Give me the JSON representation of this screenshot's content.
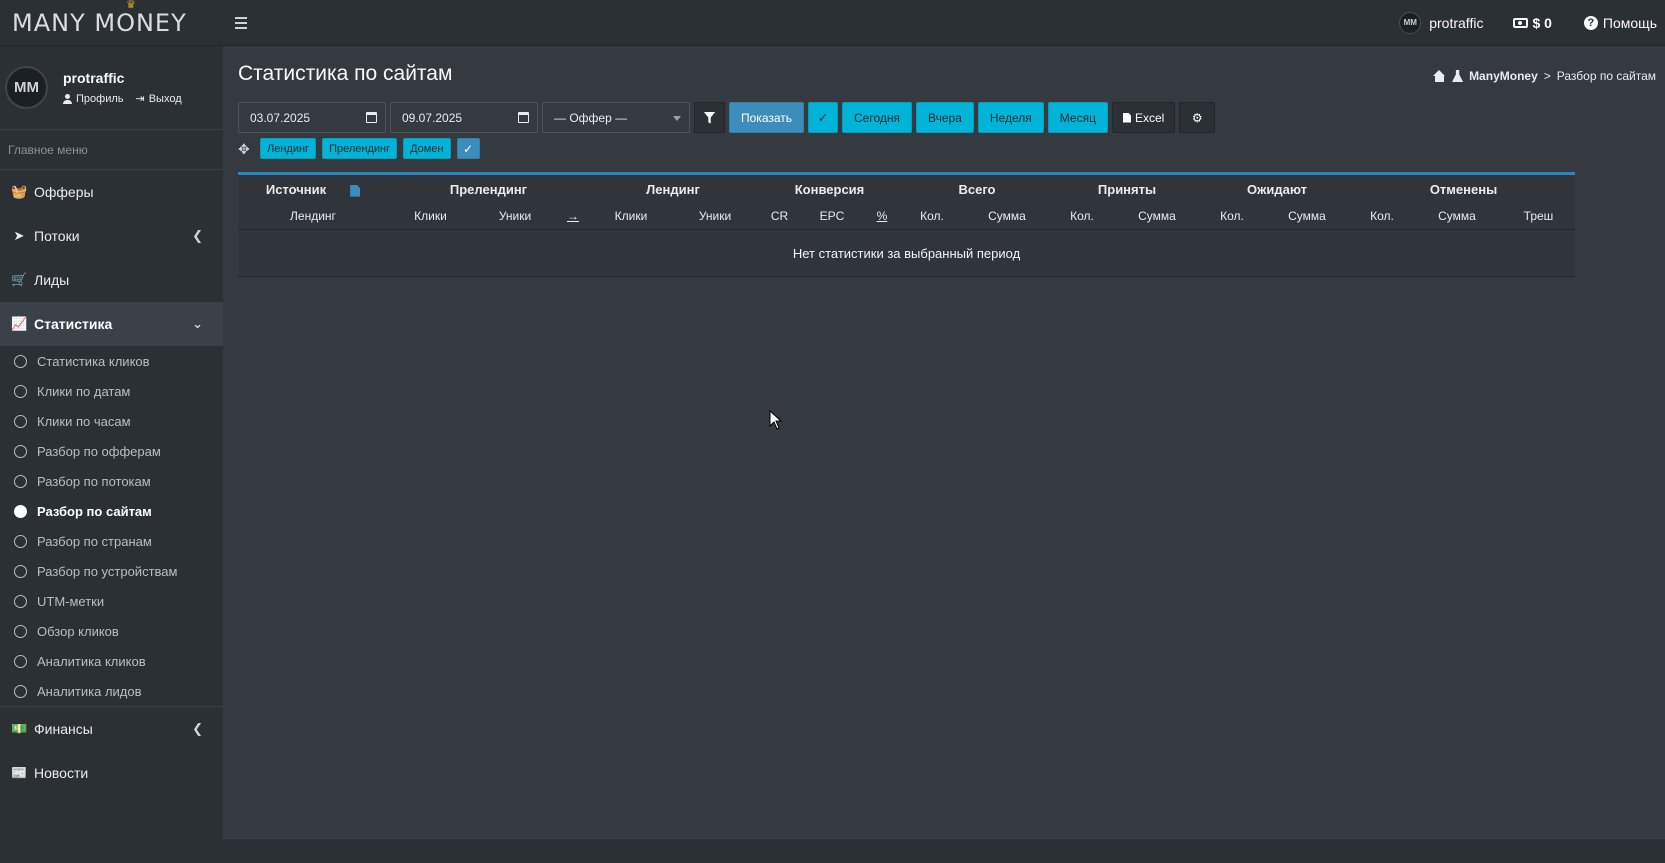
{
  "brand": {
    "logo_text": "MANY MONEY",
    "crown": "♛"
  },
  "topbar": {
    "user": "protraffic",
    "avatar_text": "MM",
    "balance": "$ 0",
    "help": "Помощь"
  },
  "sidebar": {
    "user_name": "protraffic",
    "avatar_text": "MM",
    "profile_link": "Профиль",
    "logout_link": "Выход",
    "menu_header": "Главное меню",
    "items": [
      {
        "label": "Офферы",
        "icon": "basket-icon"
      },
      {
        "label": "Потоки",
        "icon": "paper-plane-icon"
      },
      {
        "label": "Лиды",
        "icon": "cart-icon"
      },
      {
        "label": "Статистика",
        "icon": "chart-area-icon"
      },
      {
        "label": "Финансы",
        "icon": "money-icon"
      },
      {
        "label": "Новости",
        "icon": "newspaper-icon"
      }
    ],
    "stats_sub": [
      "Статистика кликов",
      "Клики по датам",
      "Клики по часам",
      "Разбор по офферам",
      "Разбор по потокам",
      "Разбор по сайтам",
      "Разбор по странам",
      "Разбор по устройствам",
      "UTM-метки",
      "Обзор кликов",
      "Аналитика кликов",
      "Аналитика лидов"
    ]
  },
  "page": {
    "title": "Статистика по сайтам",
    "breadcrumb": {
      "root": "ManyMoney",
      "sep": ">",
      "current": "Разбор по сайтам"
    }
  },
  "filters": {
    "date_from": "03.07.2025",
    "date_to": "09.07.2025",
    "offer_select": "— Оффер —",
    "show": "Показать",
    "today": "Сегодня",
    "yesterday": "Вчера",
    "week": "Неделя",
    "month": "Месяц",
    "excel": "Excel"
  },
  "group_chips": [
    "Лендинг",
    "Прелендинг",
    "Домен"
  ],
  "table": {
    "groups": [
      "Источник",
      "Прелендинг",
      "Лендинг",
      "Конверсия",
      "Всего",
      "Приняты",
      "Ожидают",
      "Отменены"
    ],
    "subheaders": [
      "Лендинг",
      "Клики",
      "Уники",
      "→",
      "Клики",
      "Уники",
      "CR",
      "EPC",
      "%",
      "Кол.",
      "Сумма",
      "Кол.",
      "Сумма",
      "Кол.",
      "Сумма",
      "Кол.",
      "Сумма",
      "Треш"
    ],
    "empty_message": "Нет статистики за выбранный период"
  },
  "colors": {
    "accent": "#00b4d8",
    "primary": "#3c8dbc",
    "sidebar": "#2b3035",
    "content": "#343a40"
  }
}
